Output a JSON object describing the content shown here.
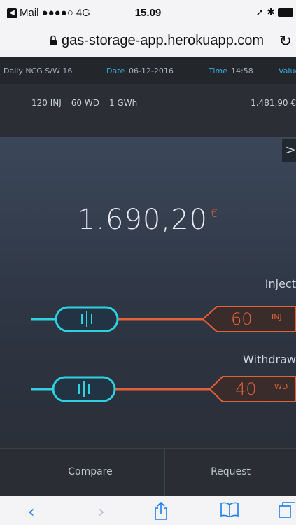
{
  "status_bar": {
    "carrier": "Mail",
    "signal": "●●●●○",
    "network": "4G",
    "time": "15.09"
  },
  "browser": {
    "url": "gas-storage-app.herokuapp.com"
  },
  "header": {
    "product": "Daily NCG S/W 16",
    "date_label": "Date",
    "date_value": "06-12-2016",
    "time_label": "Time",
    "time_value": "14:58",
    "value_label": "Value"
  },
  "summary": {
    "inject": "120 INJ",
    "withdraw": "60 WD",
    "volume": "1 GWh",
    "total": "1.481,90 €"
  },
  "main": {
    "price": "1.690,20",
    "currency": "€",
    "close_label": ">",
    "inject_label": "Inject",
    "inject_value": "60",
    "inject_unit": "INJ",
    "withdraw_label": "Withdraw",
    "withdraw_value": "40",
    "withdraw_unit": "WD"
  },
  "actions": {
    "compare": "Compare",
    "request": "Request"
  },
  "colors": {
    "accent_cyan": "#2fd0df",
    "accent_orange": "#e0613a",
    "header_blue": "#3aa9df"
  }
}
